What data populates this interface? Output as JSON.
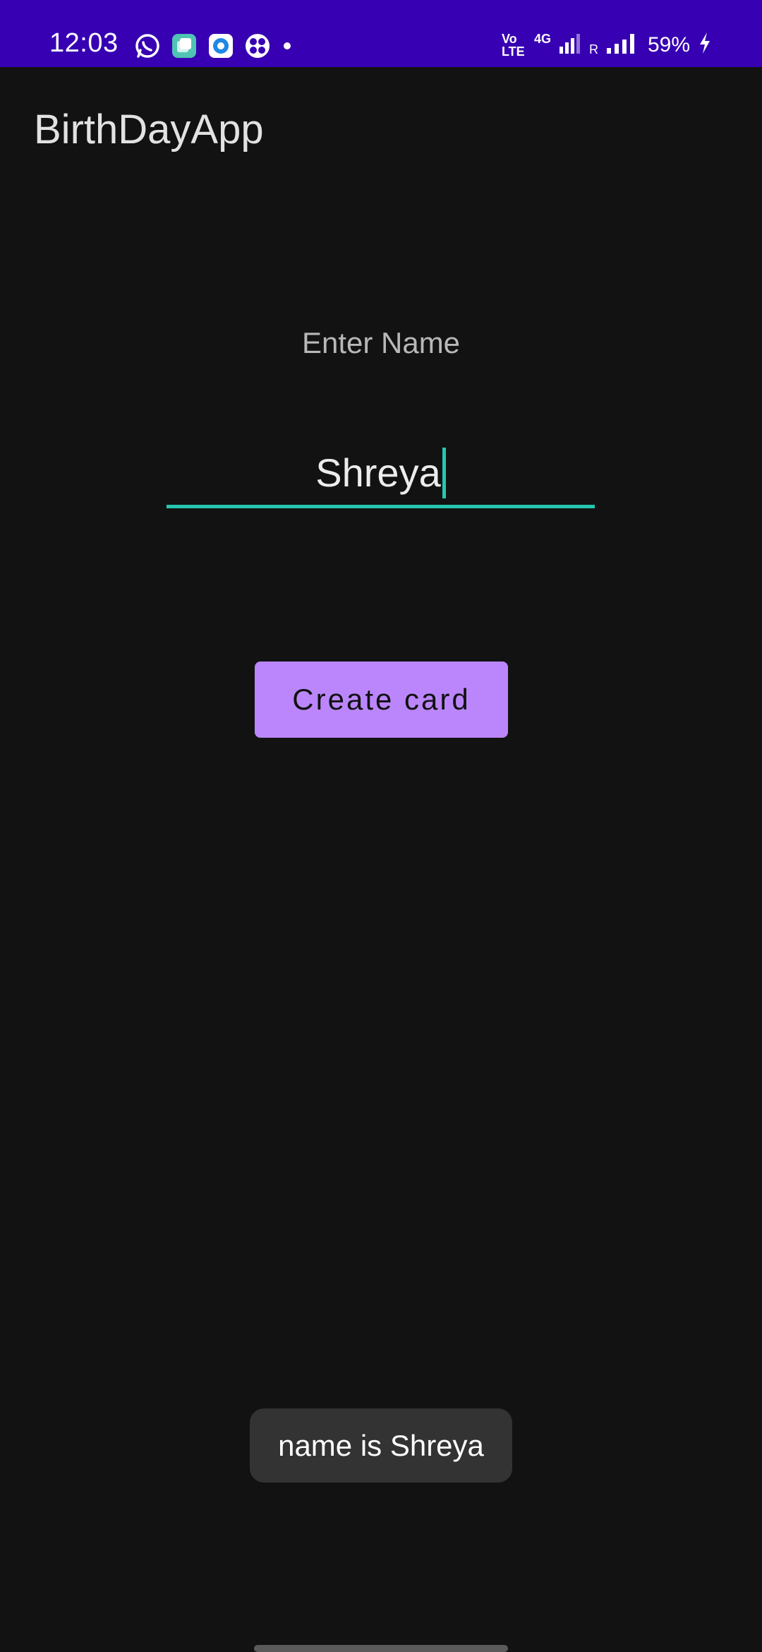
{
  "status_bar": {
    "time": "12:03",
    "battery": "59%",
    "network_labels": {
      "volte": "Vo LTE",
      "network": "4G",
      "roaming": "R"
    },
    "icons": [
      "whatsapp-icon",
      "app-icon",
      "browser-icon",
      "app-grid-icon",
      "notification-dot-icon",
      "signal-icon",
      "battery-charging-icon"
    ],
    "background": "#3700b3"
  },
  "app_bar": {
    "title": "BirthDayApp"
  },
  "form": {
    "label": "Enter Name",
    "name_value": "Shreya",
    "accent": "#26c6b0",
    "button_label": "Create card",
    "button_color": "#bb86fc"
  },
  "toast": {
    "message": "name is Shreya"
  }
}
